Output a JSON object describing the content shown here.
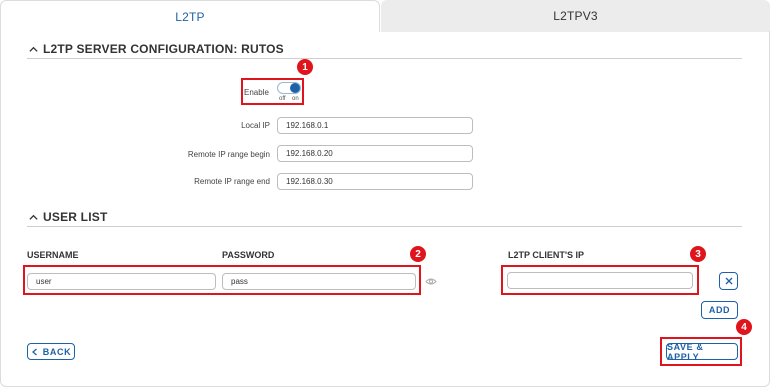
{
  "tabs": [
    {
      "label": "L2TP"
    },
    {
      "label": "L2TPV3"
    }
  ],
  "server_section": {
    "title": "L2TP SERVER CONFIGURATION: RUTOS",
    "enable_label": "Enable",
    "toggle_off": "off",
    "toggle_on": "on",
    "local_ip_label": "Local IP",
    "local_ip_value": "192.168.0.1",
    "range_begin_label": "Remote IP range begin",
    "range_begin_value": "192.168.0.20",
    "range_end_label": "Remote IP range end",
    "range_end_value": "192.168.0.30"
  },
  "user_section": {
    "title": "USER LIST",
    "col_username": "USERNAME",
    "col_password": "PASSWORD",
    "col_client_ip": "L2TP CLIENT'S IP",
    "row": {
      "username": "user",
      "password": "pass",
      "client_ip": ""
    },
    "add_label": "ADD"
  },
  "footer": {
    "back_label": "BACK",
    "save_label": "SAVE & APPLY"
  },
  "callouts": [
    "1",
    "2",
    "3",
    "4"
  ],
  "colors": {
    "accent": "#1d62a8",
    "callout": "#e0141c",
    "border": "#dcdcdc"
  },
  "icons": [
    "chevron-up-icon",
    "eye-icon",
    "close-icon",
    "chevron-left-icon"
  ]
}
